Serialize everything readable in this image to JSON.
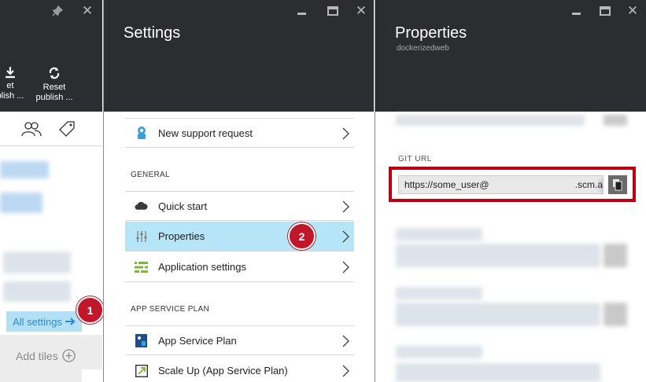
{
  "left_blade": {
    "commands": [
      {
        "icon": "download-icon",
        "line1": "et",
        "line2": "blish ..."
      },
      {
        "icon": "reset-icon",
        "line1": "Reset",
        "line2": "publish ..."
      }
    ],
    "all_settings_label": "All settings",
    "add_tiles_label": "Add tiles",
    "badge_1": "1"
  },
  "settings_blade": {
    "title": "Settings",
    "items_top": [
      {
        "icon": "support-icon",
        "label": "New support request"
      }
    ],
    "general_heading": "GENERAL",
    "general_items": [
      {
        "icon": "cloud-icon",
        "label": "Quick start"
      },
      {
        "icon": "properties-icon",
        "label": "Properties",
        "selected": true
      },
      {
        "icon": "app-settings-icon",
        "label": "Application settings"
      }
    ],
    "badge_2": "2",
    "app_service_heading": "APP SERVICE PLAN",
    "app_service_items": [
      {
        "icon": "app-service-plan-icon",
        "label": "App Service Plan"
      },
      {
        "icon": "scale-up-icon",
        "label": "Scale Up (App Service Plan)"
      }
    ]
  },
  "properties_blade": {
    "title": "Properties",
    "subtitle": "dockerizedweb",
    "git_url_label": "GIT URL",
    "git_url_prefix": "https://some_user@",
    "git_url_suffix": ".scm.a"
  },
  "colors": {
    "header_bg": "#2b2d31",
    "selected_bg": "#b5e5f6",
    "badge_red": "#c0182a",
    "highlight_red": "#c00010",
    "link_blue": "#2b8ad0"
  }
}
